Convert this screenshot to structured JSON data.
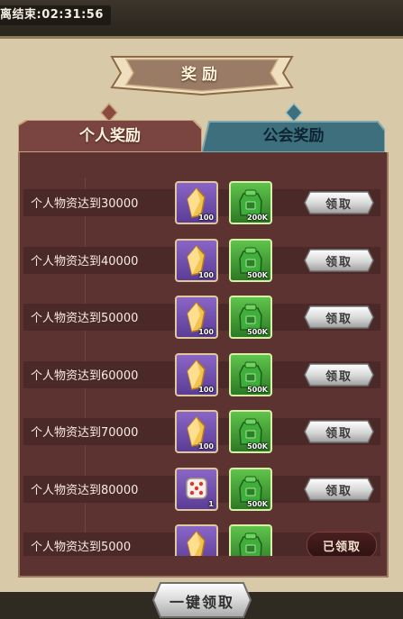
{
  "timer": {
    "text": "离结束:02:31:56"
  },
  "title": "奖励",
  "tabs": [
    {
      "label": "个人奖励",
      "active": true
    },
    {
      "label": "公会奖励",
      "active": false
    }
  ],
  "colors": {
    "panel": "#5c3331",
    "frame": "#d8c9a8",
    "tab_active": "#7a4541",
    "tab_inactive": "#3d6f7c"
  },
  "rewards": [
    {
      "label": "个人物资达到30000",
      "item1": {
        "icon": "crystal-icon",
        "qty": "100"
      },
      "item2": {
        "icon": "supply-bag-icon",
        "qty": "200K"
      },
      "button": "领取"
    },
    {
      "label": "个人物资达到40000",
      "item1": {
        "icon": "crystal-icon",
        "qty": "100"
      },
      "item2": {
        "icon": "supply-bag-icon",
        "qty": "500K"
      },
      "button": "领取"
    },
    {
      "label": "个人物资达到50000",
      "item1": {
        "icon": "crystal-icon",
        "qty": "100"
      },
      "item2": {
        "icon": "supply-bag-icon",
        "qty": "500K"
      },
      "button": "领取"
    },
    {
      "label": "个人物资达到60000",
      "item1": {
        "icon": "crystal-icon",
        "qty": "100"
      },
      "item2": {
        "icon": "supply-bag-icon",
        "qty": "500K"
      },
      "button": "领取"
    },
    {
      "label": "个人物资达到70000",
      "item1": {
        "icon": "crystal-icon",
        "qty": "100"
      },
      "item2": {
        "icon": "supply-bag-icon",
        "qty": "500K"
      },
      "button": "领取"
    },
    {
      "label": "个人物资达到80000",
      "item1": {
        "icon": "dice-icon",
        "qty": "1"
      },
      "item2": {
        "icon": "supply-bag-icon",
        "qty": "500K"
      },
      "button": "领取"
    },
    {
      "label": "个人物资达到5000",
      "item1": {
        "icon": "crystal-icon",
        "qty": ""
      },
      "item2": {
        "icon": "supply-bag-icon",
        "qty": ""
      },
      "button": "已领取"
    }
  ],
  "bottom_button": "一键领取"
}
